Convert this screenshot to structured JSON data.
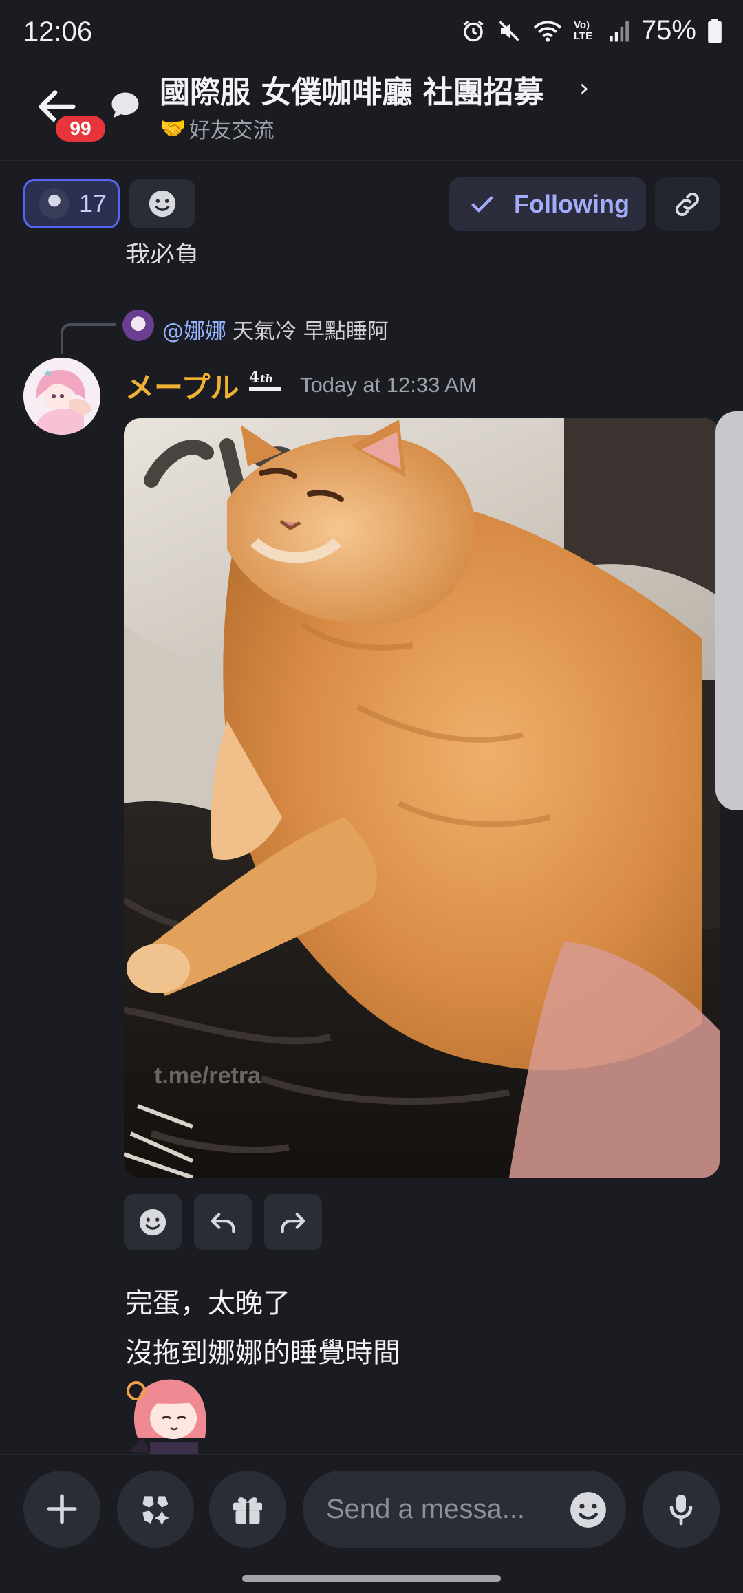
{
  "status_bar": {
    "time": "12:06",
    "battery": "75%",
    "volte": "Vo) LTE"
  },
  "header": {
    "unread_count": "99",
    "title": "國際服 女僕咖啡廳 社團招募",
    "chevron": "›",
    "subtitle_emoji": "🤝",
    "subtitle": "好友交流"
  },
  "toolbar": {
    "member_count": "17",
    "follow_label": "Following"
  },
  "messages": {
    "previous_partial": "我必負",
    "reply": {
      "mention": "@娜娜",
      "text": "天氣冷 早點睡阿"
    },
    "author": {
      "name": "メープル",
      "badge": "4th ANNIVERSARY",
      "timestamp": "Today at 12:33 AM"
    },
    "media_watermark": "t.me/retra",
    "text_line1": "完蛋，太晚了",
    "text_line2": "沒拖到娜娜的睡覺時間"
  },
  "composer": {
    "placeholder": "Send a messa..."
  },
  "colors": {
    "background": "#1b1c22",
    "accent": "#5865f2",
    "author_name": "#f0b132",
    "mention": "#96b5ff",
    "badge_red": "#e8353c"
  },
  "icons": [
    "back-arrow-icon",
    "thread-bubble-icon",
    "emoji-icon",
    "check-icon",
    "link-icon",
    "reply-icon",
    "forward-icon",
    "plus-icon",
    "apps-icon",
    "gift-icon",
    "microphone-icon",
    "alarm-icon",
    "mute-icon",
    "wifi-icon",
    "signal-icon",
    "battery-icon"
  ]
}
